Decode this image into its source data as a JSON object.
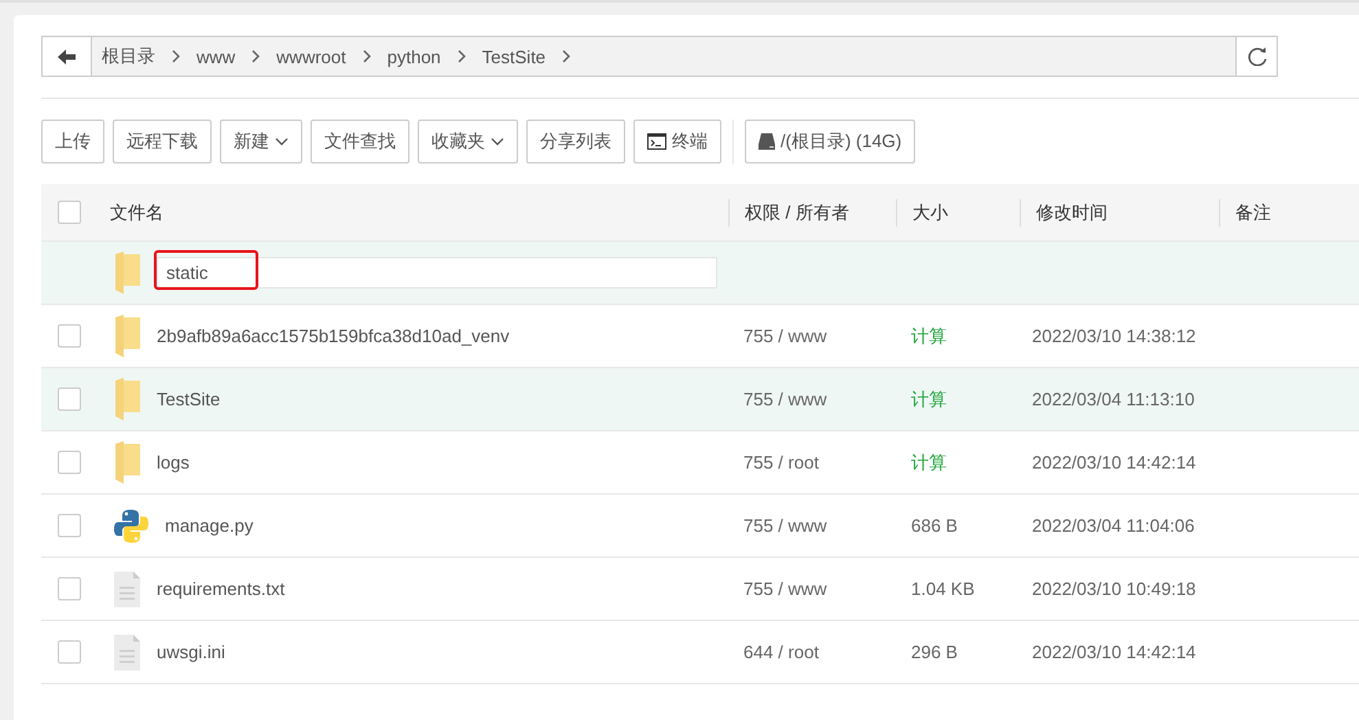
{
  "breadcrumb": {
    "items": [
      "根目录",
      "www",
      "wwwroot",
      "python",
      "TestSite"
    ]
  },
  "toolbar": [
    {
      "label": "上传",
      "kind": "plain"
    },
    {
      "label": "远程下载",
      "kind": "plain"
    },
    {
      "label": "新建",
      "kind": "dropdown"
    },
    {
      "label": "文件查找",
      "kind": "plain"
    },
    {
      "label": "收藏夹",
      "kind": "dropdown"
    },
    {
      "label": "分享列表",
      "kind": "plain"
    },
    {
      "label": "终端",
      "kind": "terminal"
    },
    {
      "label": "/(根目录) (14G)",
      "kind": "disk"
    }
  ],
  "table": {
    "select_all_checked": false,
    "columns": [
      "文件名",
      "权限 / 所有者",
      "大小",
      "修改时间",
      "备注"
    ],
    "new_folder": {
      "value": "static"
    },
    "rows": [
      {
        "name": "2b9afb89a6acc1575b159bfca38d10ad_venv",
        "kind": "folder",
        "perm": "755 / www",
        "size": {
          "text": "计算",
          "kind": "link"
        },
        "time": "2022/03/10 14:38:12",
        "highlighted": false,
        "checked": false
      },
      {
        "name": "TestSite",
        "kind": "folder",
        "perm": "755 / www",
        "size": {
          "text": "计算",
          "kind": "link"
        },
        "time": "2022/03/04 11:13:10",
        "highlighted": true,
        "checked": false
      },
      {
        "name": "logs",
        "kind": "folder",
        "perm": "755 / root",
        "size": {
          "text": "计算",
          "kind": "link"
        },
        "time": "2022/03/10 14:42:14",
        "highlighted": false,
        "checked": false
      },
      {
        "name": "manage.py",
        "kind": "python",
        "perm": "755 / www",
        "size": {
          "text": "686 B",
          "kind": "plain"
        },
        "time": "2022/03/04 11:04:06",
        "highlighted": false,
        "checked": false
      },
      {
        "name": "requirements.txt",
        "kind": "text",
        "perm": "755 / www",
        "size": {
          "text": "1.04 KB",
          "kind": "plain"
        },
        "time": "2022/03/10 10:49:18",
        "highlighted": false,
        "checked": false
      },
      {
        "name": "uwsgi.ini",
        "kind": "text",
        "perm": "644 / root",
        "size": {
          "text": "296 B",
          "kind": "plain"
        },
        "time": "2022/03/10 14:42:14",
        "highlighted": false,
        "checked": false
      }
    ]
  }
}
